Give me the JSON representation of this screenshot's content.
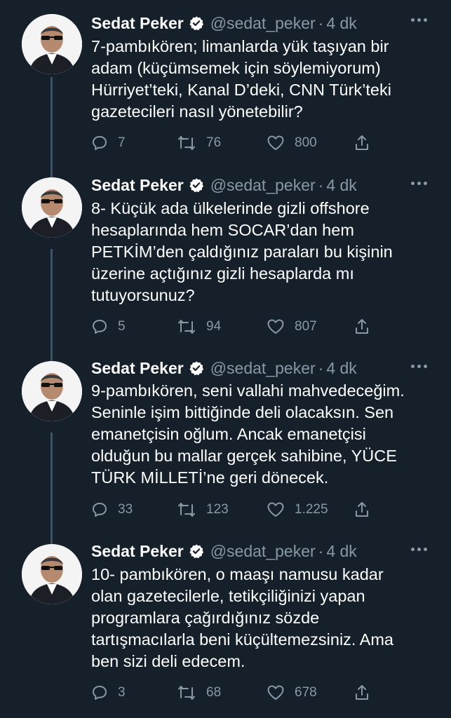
{
  "author": {
    "name": "Sedat Peker",
    "handle": "@sedat_peker",
    "separator": "·",
    "time": "4 dk"
  },
  "colors": {
    "background": "#15202b",
    "secondary_text": "#8899a6",
    "thread_line": "#3d5466",
    "verified": "#ffffff"
  },
  "tweets": [
    {
      "lines": [
        "7-pambıkören; limanlarda yük taşıyan bir",
        "adam (küçümsemek için söylemiyorum)",
        "Hürriyet’teki, Kanal D’deki, CNN Türk’teki",
        "gazetecileri nasıl yönetebilir?"
      ],
      "replies": "7",
      "retweets": "76",
      "likes": "800"
    },
    {
      "lines": [
        "8- Küçük ada ülkelerinde gizli offshore",
        "hesaplarında hem SOCAR’dan hem",
        "PETKİM’den çaldığınız paraları bu kişinin",
        "üzerine açtığınız gizli hesaplarda mı",
        "tutuyorsunuz?"
      ],
      "replies": "5",
      "retweets": "94",
      "likes": "807"
    },
    {
      "lines": [
        "9-pambıkören, seni vallahi mahvedeceğim.",
        "Seninle işim bittiğinde deli olacaksın. Sen",
        "emanetçisin oğlum. Ancak emanetçisi",
        "olduğun bu mallar gerçek sahibine, YÜCE",
        "TÜRK MİLLETİ’ne geri dönecek."
      ],
      "replies": "33",
      "retweets": "123",
      "likes": "1.225"
    },
    {
      "lines": [
        "10- pambıkören, o maaşı namusu kadar",
        "olan gazetecilerle, tetikçiliğinizi yapan",
        "programlara çağırdığınız sözde",
        "tartışmacılarla beni küçültemezsiniz. Ama",
        "ben sizi deli edecem."
      ],
      "replies": "3",
      "retweets": "68",
      "likes": "678"
    }
  ]
}
